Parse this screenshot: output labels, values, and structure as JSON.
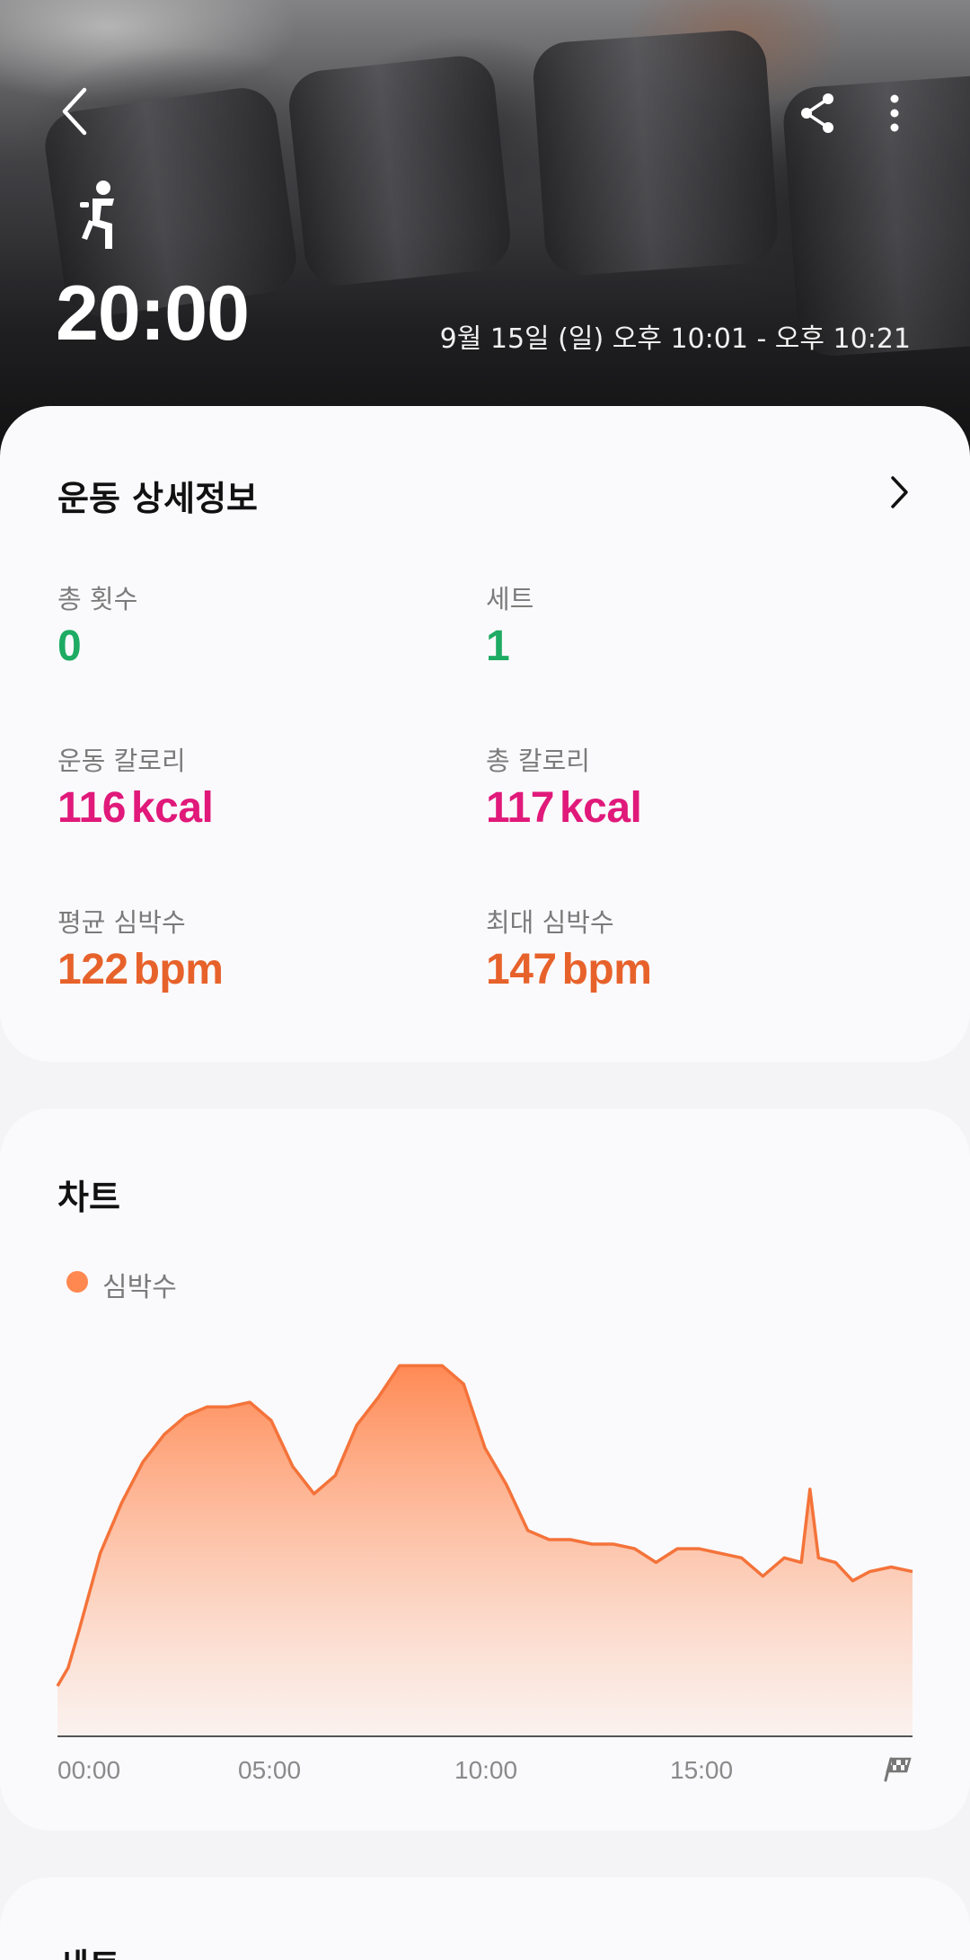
{
  "header": {
    "duration": "20:00",
    "date_range": "9월 15일 (일) 오후 10:01 - 오후 10:21",
    "icons": {
      "back": "chevron-left-icon",
      "share": "share-icon",
      "more": "more-vertical-icon",
      "exercise": "squat-exercise-icon"
    }
  },
  "details": {
    "title": "운동 상세정보",
    "stats": [
      {
        "label": "총 횟수",
        "value": "0",
        "unit": "",
        "color": "#1eab63"
      },
      {
        "label": "세트",
        "value": "1",
        "unit": "",
        "color": "#1eab63"
      },
      {
        "label": "운동 칼로리",
        "value": "116",
        "unit": "kcal",
        "color": "#e0197a"
      },
      {
        "label": "총 칼로리",
        "value": "117",
        "unit": "kcal",
        "color": "#e0197a"
      },
      {
        "label": "평균 심박수",
        "value": "122",
        "unit": "bpm",
        "color": "#e7622b"
      },
      {
        "label": "최대 심박수",
        "value": "147",
        "unit": "bpm",
        "color": "#e7622b"
      }
    ]
  },
  "chart": {
    "title": "차트",
    "legend": "심박수"
  },
  "chart_data": {
    "type": "area",
    "series": [
      {
        "name": "심박수",
        "color": "#ff8850",
        "x": [
          0,
          0.25,
          0.5,
          1.0,
          1.5,
          2.0,
          2.5,
          3.0,
          3.5,
          4.0,
          4.5,
          5.0,
          5.5,
          6.0,
          6.5,
          7.0,
          7.5,
          8.0,
          8.5,
          9.0,
          9.5,
          10.0,
          10.5,
          11.0,
          11.5,
          12.0,
          12.5,
          13.0,
          13.5,
          14.0,
          14.5,
          15.0,
          15.5,
          16.0,
          16.5,
          17.0,
          17.4,
          17.6,
          17.8,
          18.2,
          18.6,
          19.0,
          19.5,
          20.0
        ],
        "y": [
          76,
          80,
          88,
          105,
          116,
          125,
          131,
          135,
          137,
          137,
          138,
          134,
          124,
          118,
          122,
          133,
          139,
          146,
          146,
          146,
          142,
          128,
          120,
          110,
          108,
          108,
          107,
          107,
          106,
          103,
          106,
          106,
          105,
          104,
          100,
          104,
          103,
          119,
          104,
          103,
          99,
          101,
          102,
          101
        ]
      }
    ],
    "xlim": [
      0,
      20
    ],
    "ylim": [
      65,
      150
    ],
    "x_tick_labels": [
      "00:00",
      "05:00",
      "10:00",
      "15:00"
    ],
    "end_marker": "checkered-flag-icon",
    "grid": false,
    "legend_position": "top-left"
  },
  "next_section": {
    "title": "세트"
  }
}
